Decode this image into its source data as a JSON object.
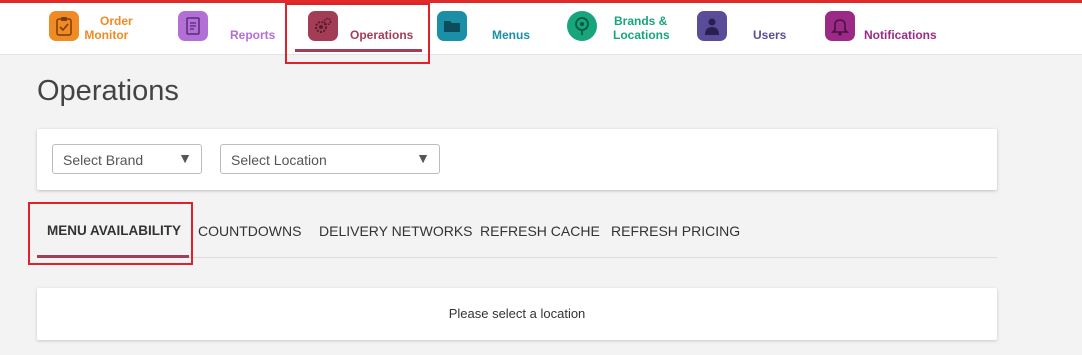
{
  "colors": {
    "accent": "#e02a2a",
    "active_underline": "#a33d56",
    "order_monitor": "#f08a24",
    "reports": "#b26fd6",
    "operations": "#a33d56",
    "menus": "#1a8fa6",
    "brands": "#17a57c",
    "users": "#5b4c99",
    "notifications": "#9b2a86"
  },
  "nav": {
    "items": [
      {
        "line1": "Order",
        "line2": "Monitor",
        "icon": "clipboard-icon"
      },
      {
        "label": "Reports",
        "icon": "report-icon"
      },
      {
        "label": "Operations",
        "icon": "gears-icon"
      },
      {
        "label": "Menus",
        "icon": "folder-icon"
      },
      {
        "line1": "Brands &",
        "line2": "Locations",
        "icon": "map-pin-icon"
      },
      {
        "label": "Users",
        "icon": "user-icon"
      },
      {
        "label": "Notifications",
        "icon": "bell-icon"
      }
    ]
  },
  "page": {
    "title": "Operations"
  },
  "filters": {
    "brand": {
      "value": "Select Brand",
      "caret": "▼"
    },
    "location": {
      "value": "Select Location",
      "caret": "▼"
    }
  },
  "tabs": [
    {
      "label": "MENU AVAILABILITY"
    },
    {
      "label": "COUNTDOWNS"
    },
    {
      "label": "DELIVERY NETWORKS"
    },
    {
      "label": "REFRESH CACHE"
    },
    {
      "label": "REFRESH PRICING"
    }
  ],
  "message": {
    "text": "Please select a location"
  }
}
